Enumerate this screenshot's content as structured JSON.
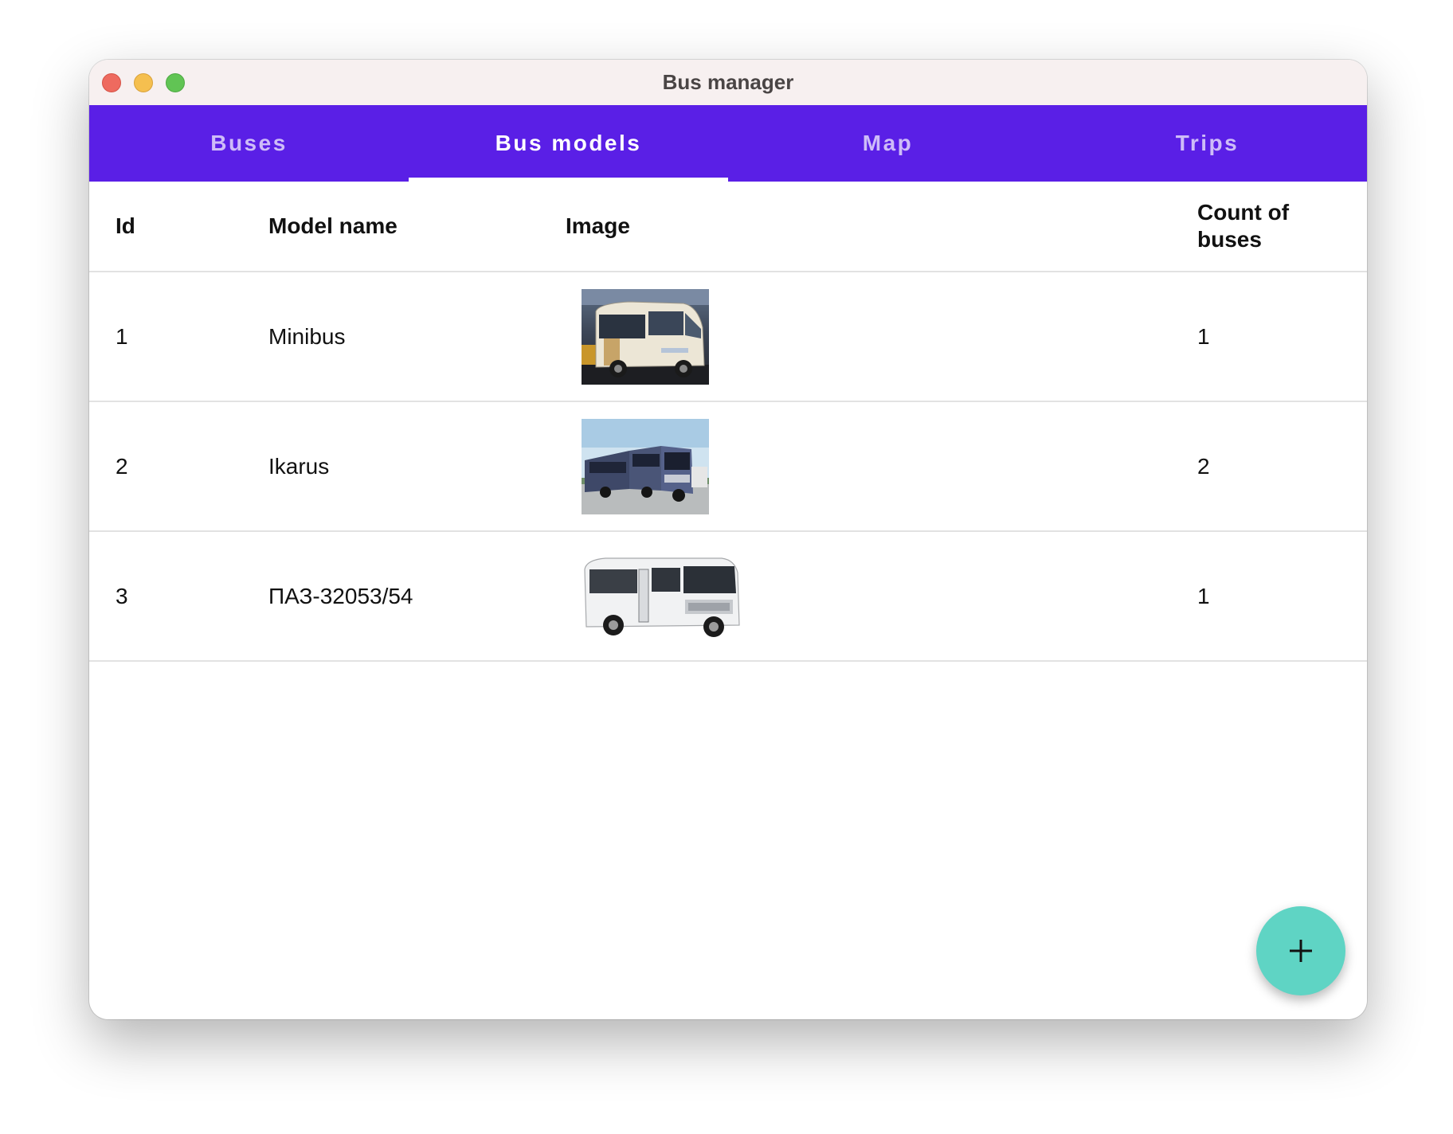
{
  "window": {
    "title": "Bus manager"
  },
  "tabs": [
    {
      "label": "Buses",
      "active": false
    },
    {
      "label": "Bus models",
      "active": true
    },
    {
      "label": "Map",
      "active": false
    },
    {
      "label": "Trips",
      "active": false
    }
  ],
  "table": {
    "columns": {
      "id": "Id",
      "model_name": "Model name",
      "image": "Image",
      "count_line1": "Count of",
      "count_line2": "buses"
    },
    "rows": [
      {
        "id": "1",
        "model_name": "Minibus",
        "image": "minibus-photo",
        "count": "1"
      },
      {
        "id": "2",
        "model_name": "Ikarus",
        "image": "ikarus-bus-photo",
        "count": "2"
      },
      {
        "id": "3",
        "model_name": "ПАЗ-32053/54",
        "image": "paz-bus-photo",
        "count": "1"
      }
    ]
  },
  "fab": {
    "icon": "plus-icon"
  },
  "colors": {
    "accent": "#5a1fe6",
    "fab": "#5fd4c4",
    "titlebar": "#f7f0f0"
  }
}
